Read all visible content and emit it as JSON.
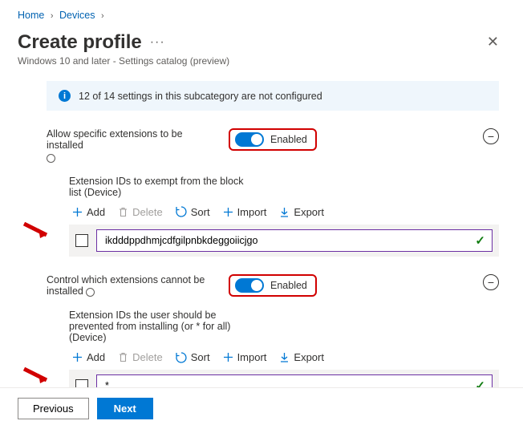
{
  "breadcrumb": {
    "home": "Home",
    "devices": "Devices"
  },
  "header": {
    "title": "Create profile",
    "subtitle": "Windows 10 and later - Settings catalog (preview)"
  },
  "info_bar": {
    "text": "12 of 14 settings in this subcategory are not configured"
  },
  "setting1": {
    "label": "Allow specific extensions to be installed",
    "toggle_text": "Enabled",
    "sub_label": "Extension IDs to exempt from the block list (Device)",
    "value": "ikdddppdhmjcdfgilpnbkdeggoiicjgo"
  },
  "setting2": {
    "label": "Control which extensions cannot be installed",
    "toggle_text": "Enabled",
    "sub_label": "Extension IDs the user should be prevented from installing (or * for all) (Device)",
    "value": "*"
  },
  "toolbar": {
    "add": "Add",
    "delete": "Delete",
    "sort": "Sort",
    "import": "Import",
    "export": "Export"
  },
  "footer": {
    "prev": "Previous",
    "next": "Next"
  }
}
